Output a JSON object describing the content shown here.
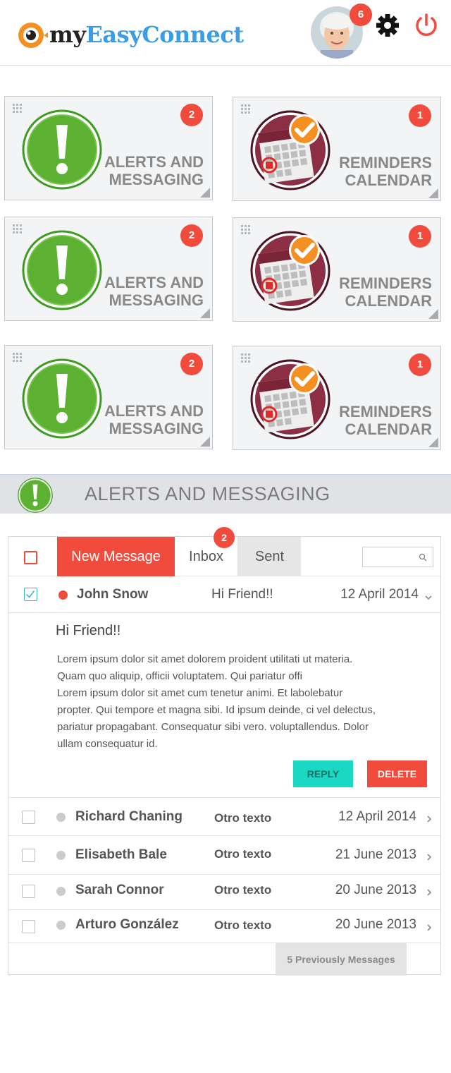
{
  "header": {
    "logo_prefix": "my",
    "logo_suffix": "EasyConnect",
    "notification_count": "6",
    "icons": [
      "logo-eye-icon",
      "avatar-photo",
      "gear-icon",
      "power-icon"
    ]
  },
  "colors": {
    "accent_red": "#f04b3c",
    "logo_orange": "#f39021",
    "logo_blue": "#3a9ee4",
    "reply_teal": "#1ad8c2",
    "alert_green": "#5cb133",
    "calendar_maroon": "#8c2f45"
  },
  "tiles": [
    {
      "label": "ALERTS AND\nMESSAGING",
      "badge": "2",
      "icon": "alert-icon"
    },
    {
      "label": "REMINDERS\nCALENDAR",
      "badge": "1",
      "icon": "calendar-icon"
    },
    {
      "label": "ALERTS AND\nMESSAGING",
      "badge": "2",
      "icon": "alert-icon"
    },
    {
      "label": "REMINDERS\nCALENDAR",
      "badge": "1",
      "icon": "calendar-icon"
    },
    {
      "label": "ALERTS AND\nMESSAGING",
      "badge": "2",
      "icon": "alert-icon"
    },
    {
      "label": "REMINDERS\nCALENDAR",
      "badge": "1",
      "icon": "calendar-icon"
    }
  ],
  "section": {
    "title": "ALERTS AND MESSAGING"
  },
  "messaging": {
    "new_message_label": "New Message",
    "inbox_label": "Inbox",
    "inbox_count": "2",
    "sent_label": "Sent",
    "search_placeholder": "",
    "open_message": {
      "sender": "John Snow",
      "subject": "Hi Friend!!",
      "date": "12 April 2014",
      "title": "Hi Friend!!",
      "body_lines": [
        "Lorem ipsum dolor sit amet dolorem proident utilitati ut materia.",
        "Quam quo aliquip, officii voluptatem. Qui pariatur offi",
        "Lorem ipsum dolor sit amet cum tenetur animi. Et labolebatur",
        "propter. Qui tempore et magna sibi. Id ipsum deinde, ci vel delectus,",
        "pariatur propagabant. Consequatur sibi vero. voluptallendus. Dolor",
        "ullam consequatur id."
      ],
      "reply_label": "REPLY",
      "delete_label": "DELETE"
    },
    "messages": [
      {
        "sender": "Richard Chaning",
        "subject": "Otro texto",
        "date": "12 April 2014"
      },
      {
        "sender": "Elisabeth Bale",
        "subject": "Otro texto",
        "date": "21 June 2013"
      },
      {
        "sender": "Sarah Connor",
        "subject": "Otro texto",
        "date": "20 June 2013"
      },
      {
        "sender": "Arturo González",
        "subject": "Otro texto",
        "date": "20 June 2013"
      }
    ],
    "previous_label": "5 Previously Messages"
  }
}
